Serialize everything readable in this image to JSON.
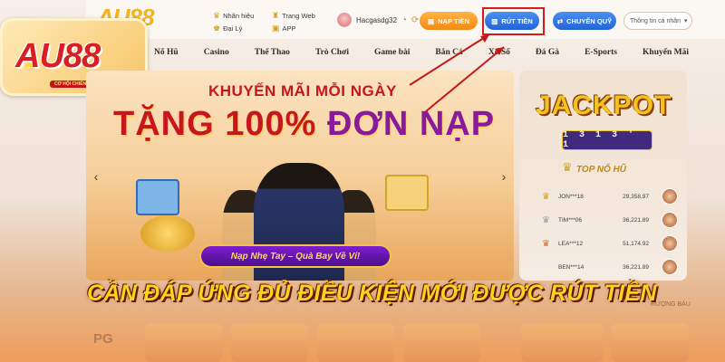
{
  "header": {
    "brand": "AU88",
    "quick_links": [
      {
        "label": "Nhãn hiệu",
        "icon": "trophy-icon"
      },
      {
        "label": "Đại Lý",
        "icon": "crown-icon"
      },
      {
        "label": "Trang Web",
        "icon": "cup-icon"
      },
      {
        "label": "APP",
        "icon": "app-icon"
      }
    ],
    "username": "Hacgasdg32",
    "buttons": {
      "deposit": "NẠP TIỀN",
      "withdraw": "RÚT TIỀN",
      "transfer": "CHUYỂN QUỸ"
    },
    "account_select": "Thông tin cá nhân"
  },
  "logo_badge": {
    "brand": "AU88",
    "tagline": "CƠ HỘI CHIẾN THẮNG"
  },
  "nav": [
    "Nổ Hũ",
    "Casino",
    "Thể Thao",
    "Trò Chơi",
    "Game bài",
    "Bắn Cá",
    "Xổ Số",
    "Đá Gà",
    "E-Sports",
    "Khuyến Mãi"
  ],
  "hero": {
    "promo_small": "KHUYẾN MÃI MỖI NGÀY",
    "promo_big_part1": "TẶNG 100%",
    "promo_big_part2": "ĐƠN NẠP",
    "slogan": "Nạp Nhẹ Tay – Quà Bay Về Ví!"
  },
  "jackpot": {
    "title": "JACKPOT",
    "digits": "1 3 1 3 ' 1",
    "top_label": "TOP NỔ HŨ",
    "rows": [
      {
        "name": "JON***18",
        "amount": "29,358.97",
        "crown": "gold"
      },
      {
        "name": "TIM***06",
        "amount": "36,221.89",
        "crown": "silver"
      },
      {
        "name": "LEA***12",
        "amount": "51,174.92",
        "crown": "bronze"
      },
      {
        "name": "BEN***14",
        "amount": "36,221.89",
        "crown": "none"
      }
    ]
  },
  "caption": "CẦN ĐÁP ỨNG ĐỦ ĐIỀU KIỆN MỚI ĐƯỢC RÚT TIỀN",
  "lower": {
    "pg": "PG",
    "suong_bau": "RƯỢNG BÁU"
  }
}
